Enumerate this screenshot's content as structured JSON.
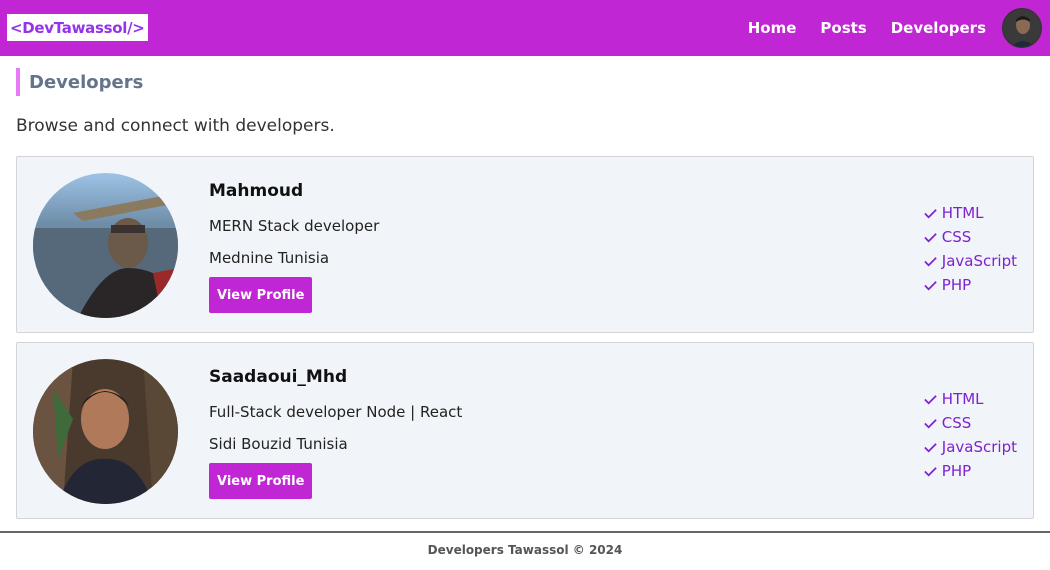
{
  "navbar": {
    "brand": "<DevTawassol/>",
    "links": [
      "Home",
      "Posts",
      "Developers"
    ]
  },
  "page": {
    "heading": "Developers",
    "lead": "Browse and connect with developers."
  },
  "developers": [
    {
      "name": "Mahmoud",
      "status": "MERN Stack developer",
      "location": "Mednine Tunisia",
      "button": "View Profile",
      "skills": [
        "HTML",
        "CSS",
        "JavaScript",
        "PHP"
      ]
    },
    {
      "name": "Saadaoui_Mhd",
      "status": "Full-Stack developer Node | React",
      "location": "Sidi Bouzid Tunisia",
      "button": "View Profile",
      "skills": [
        "HTML",
        "CSS",
        "JavaScript",
        "PHP"
      ]
    }
  ],
  "footer": {
    "text": "Developers Tawassol © 2024"
  },
  "colors": {
    "primary": "#c026d3",
    "accent_border": "#e879f9",
    "skill_text": "#7e22ce",
    "card_bg": "#f1f5f9"
  },
  "icons": {
    "skill": "check-icon"
  }
}
